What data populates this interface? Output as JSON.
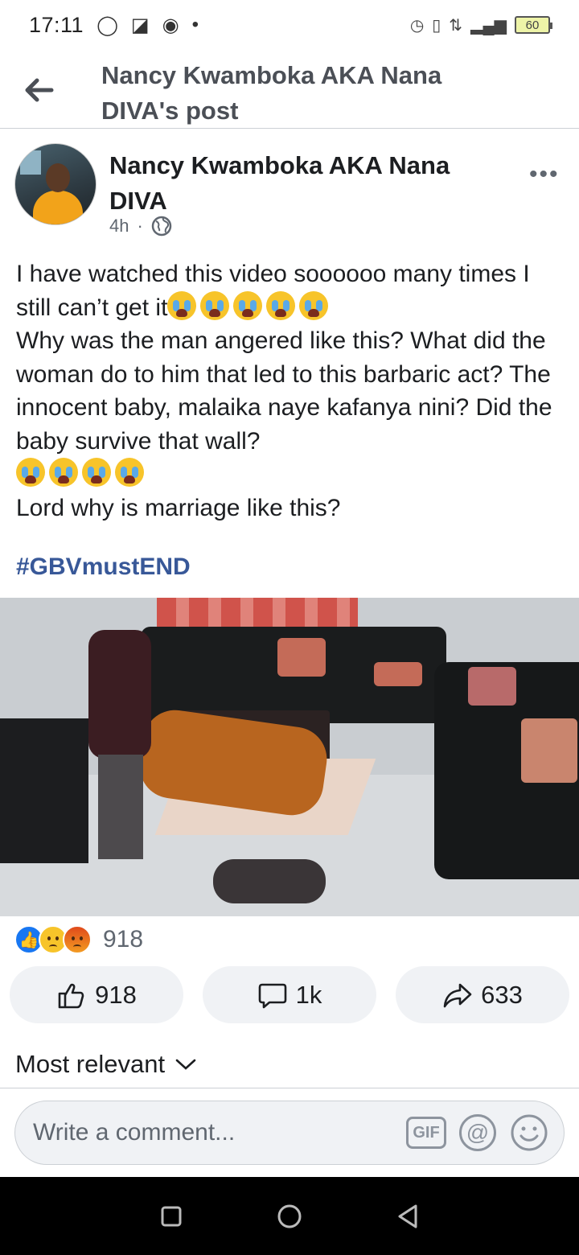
{
  "status_bar": {
    "time": "17:11",
    "battery": "60"
  },
  "header": {
    "title_line1": "Nancy Kwamboka AKA Nana",
    "title_line2": "DIVA's post"
  },
  "post": {
    "author_line1": "Nancy Kwamboka AKA Nana",
    "author_line2": "DIVA",
    "time": "4h",
    "dot": "·",
    "paragraph1_a": "I have watched this video soooooo many times I still can’t get it",
    "paragraph1_b": "Why was the man angered like this? What did the woman do to him that led to this barbaric act? The innocent baby, malaika naye kafanya nini? Did the baby survive that wall?",
    "paragraph2": "Lord why is marriage like this?",
    "hashtag": "#GBVmustEND"
  },
  "reactions": {
    "total": "918",
    "types": [
      "like-icon",
      "sad-icon",
      "angry-icon"
    ]
  },
  "actions": {
    "like_count": "918",
    "comment_count": "1k",
    "share_count": "633"
  },
  "comments": {
    "sort_label": "Most relevant",
    "placeholder": "Write a comment...",
    "gif_label": "GIF",
    "mention_label": "@"
  },
  "colors": {
    "link_blue": "#385898",
    "like_blue": "#1877f2",
    "pill_bg": "#f0f2f5"
  }
}
